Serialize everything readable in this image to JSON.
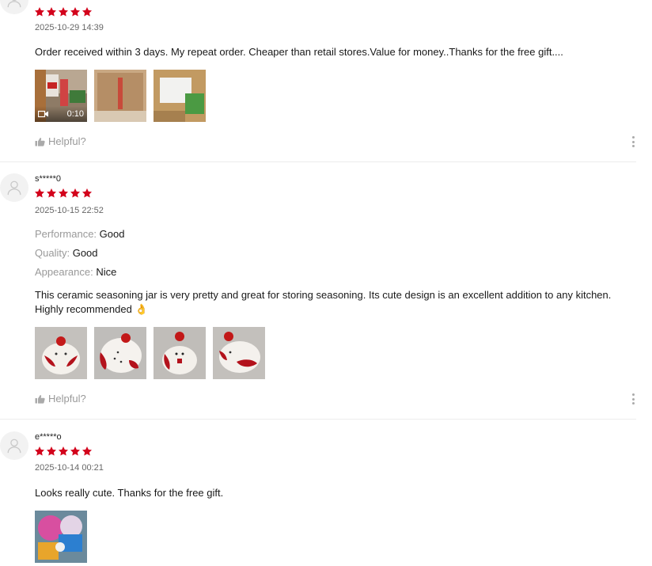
{
  "colors": {
    "star": "#d3031c",
    "muted": "#999999",
    "divider": "#ececec"
  },
  "reviews": [
    {
      "username": "",
      "rating": 5,
      "date": "2025-10-29 14:39",
      "attributes": [],
      "text": "Order received within 3 days. My repeat order. Cheaper than retail stores.Value for money..Thanks for the free gift....",
      "media": [
        {
          "type": "video",
          "duration": "0:10",
          "icon": "video-camera-icon"
        },
        {
          "type": "image"
        },
        {
          "type": "image"
        }
      ],
      "helpful_label": "Helpful?"
    },
    {
      "username": "s*****0",
      "rating": 5,
      "date": "2025-10-15 22:52",
      "attributes": [
        {
          "key": "Performance:",
          "value": "Good"
        },
        {
          "key": "Quality:",
          "value": "Good"
        },
        {
          "key": "Appearance:",
          "value": "Nice"
        }
      ],
      "text": "This ceramic seasoning jar is very pretty and great for storing seasoning. Its cute design is an excellent addition to any kitchen. Highly recommended 👌",
      "media": [
        {
          "type": "image"
        },
        {
          "type": "image"
        },
        {
          "type": "image"
        },
        {
          "type": "image"
        }
      ],
      "helpful_label": "Helpful?"
    },
    {
      "username": "e*****o",
      "rating": 5,
      "date": "2025-10-14 00:21",
      "attributes": [],
      "text": "Looks really cute. Thanks for the free gift.",
      "media": [
        {
          "type": "image"
        }
      ]
    }
  ]
}
